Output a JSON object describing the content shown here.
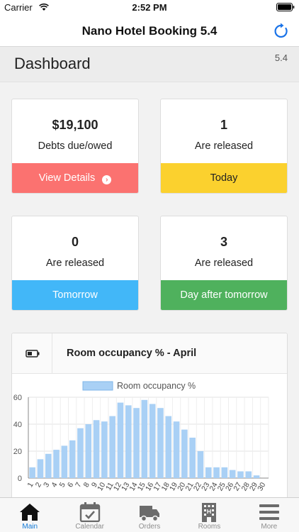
{
  "status_bar": {
    "carrier": "Carrier",
    "time": "2:52 PM"
  },
  "nav": {
    "title": "Nano Hotel Booking 5.4"
  },
  "header": {
    "title": "Dashboard",
    "version": "5.4"
  },
  "cards": [
    {
      "value": "$19,100",
      "label": "Debts due/owed",
      "button": "View Details"
    },
    {
      "value": "1",
      "label": "Are released",
      "button": "Today"
    },
    {
      "value": "0",
      "label": "Are released",
      "button": "Tomorrow"
    },
    {
      "value": "3",
      "label": "Are released",
      "button": "Day after tomorrow"
    }
  ],
  "chart_panel": {
    "title": "Room occupancy % - April"
  },
  "chart_data": {
    "type": "bar",
    "title": "",
    "xlabel": "",
    "ylabel": "",
    "ylim": [
      0,
      60
    ],
    "yticks": [
      "0",
      "20",
      "40",
      "60"
    ],
    "grid": true,
    "legend": "top-center",
    "categories": [
      "1",
      "2",
      "3",
      "4",
      "5",
      "6",
      "7",
      "8",
      "9",
      "10",
      "11",
      "12",
      "13",
      "14",
      "15",
      "16",
      "17",
      "18",
      "19",
      "20",
      "21",
      "22",
      "23",
      "24",
      "25",
      "26",
      "27",
      "28",
      "29",
      "30"
    ],
    "series": [
      {
        "name": "Room occupancy %",
        "color": "#a9d0f5",
        "values": [
          8,
          14,
          18,
          21,
          24,
          28,
          37,
          40,
          43,
          42,
          46,
          56,
          54,
          52,
          58,
          55,
          52,
          46,
          42,
          36,
          30,
          20,
          8,
          8,
          8,
          6,
          5,
          5,
          2,
          0
        ]
      }
    ]
  },
  "tabs": [
    {
      "label": "Main",
      "icon": "home-icon",
      "active": true
    },
    {
      "label": "Calendar",
      "icon": "calendar-icon",
      "active": false
    },
    {
      "label": "Orders",
      "icon": "truck-icon",
      "active": false
    },
    {
      "label": "Rooms",
      "icon": "hotel-icon",
      "active": false
    },
    {
      "label": "More",
      "icon": "menu-icon",
      "active": false
    }
  ]
}
